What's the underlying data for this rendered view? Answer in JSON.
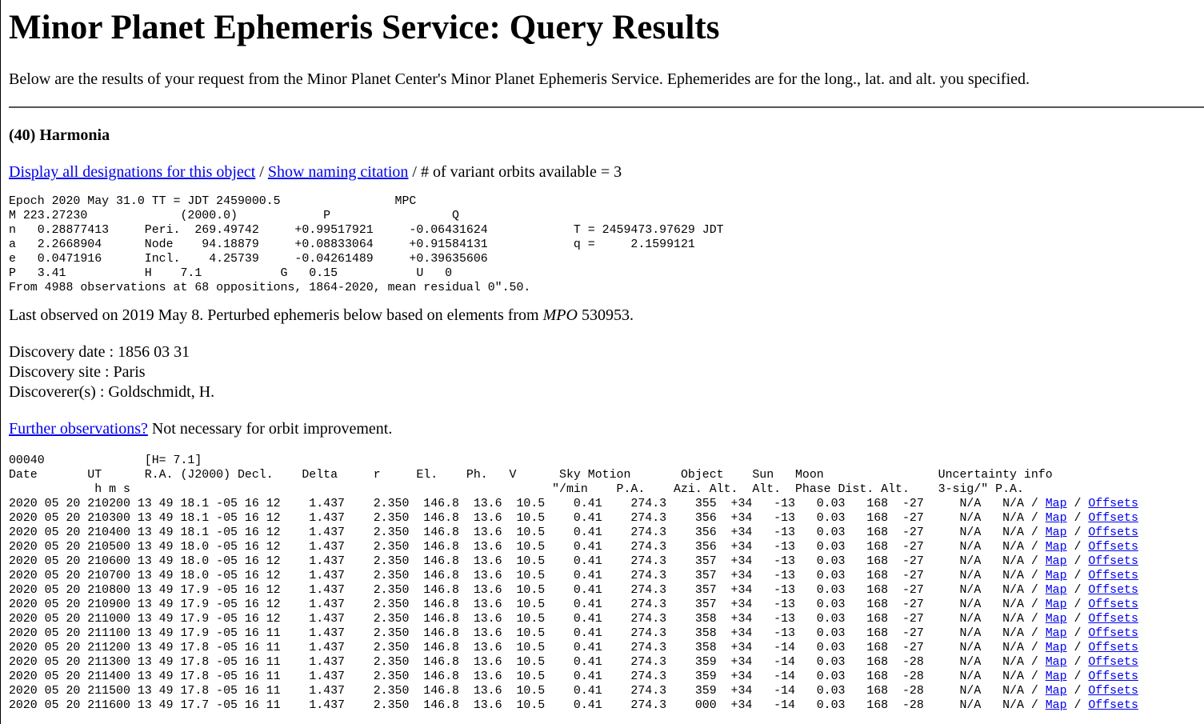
{
  "page": {
    "title": "Minor Planet Ephemeris Service: Query Results",
    "intro": "Below are the results of your request from the Minor Planet Center's Minor Planet Ephemeris Service. Ephemerides are for the long., lat. and alt. you specified."
  },
  "object": {
    "name": "(40) Harmonia",
    "link_designations": "Display all designations for this object",
    "sep1": " / ",
    "link_citation": "Show naming citation",
    "variant_text": " / # of variant orbits available = 3"
  },
  "elements_block": "Epoch 2020 May 31.0 TT = JDT 2459000.5                MPC\nM 223.27230             (2000.0)            P                 Q\nn   0.28877413     Peri.  269.49742     +0.99517921     -0.06431624            T = 2459473.97629 JDT\na   2.2668904      Node    94.18879     +0.08833064     +0.91584131            q =     2.1599121\ne   0.0471916      Incl.    4.25739     -0.04261489     +0.39635606\nP   3.41           H    7.1           G   0.15           U   0\nFrom 4988 observations at 68 oppositions, 1864-2020, mean residual 0\".50.",
  "last_observed": {
    "before": "Last observed on 2019 May 8. Perturbed ephemeris below based on elements from ",
    "italic": "MPO",
    "after": " 530953."
  },
  "discovery": {
    "date": "Discovery date : 1856 03 31",
    "site": "Discovery site : Paris",
    "discoverer": "Discoverer(s) : Goldschmidt, H."
  },
  "further": {
    "link": "Further observations?",
    "text": " Not necessary for orbit improvement."
  },
  "ephemeris": {
    "header_lines": [
      "00040              [H= 7.1]",
      "Date       UT      R.A. (J2000) Decl.    Delta     r     El.    Ph.   V      Sky Motion       Object    Sun   Moon                Uncertainty info",
      "            h m s                                                           \"/min    P.A.    Azi. Alt.  Alt.  Phase Dist. Alt.    3-sig/\" P.A."
    ],
    "rows": [
      "2020 05 20 210200 13 49 18.1 -05 16 12    1.437    2.350  146.8  13.6  10.5    0.41    274.3    355  +34   -13   0.03   168  -27     N/A   N/A / ",
      "2020 05 20 210300 13 49 18.1 -05 16 12    1.437    2.350  146.8  13.6  10.5    0.41    274.3    356  +34   -13   0.03   168  -27     N/A   N/A / ",
      "2020 05 20 210400 13 49 18.1 -05 16 12    1.437    2.350  146.8  13.6  10.5    0.41    274.3    356  +34   -13   0.03   168  -27     N/A   N/A / ",
      "2020 05 20 210500 13 49 18.0 -05 16 12    1.437    2.350  146.8  13.6  10.5    0.41    274.3    356  +34   -13   0.03   168  -27     N/A   N/A / ",
      "2020 05 20 210600 13 49 18.0 -05 16 12    1.437    2.350  146.8  13.6  10.5    0.41    274.3    357  +34   -13   0.03   168  -27     N/A   N/A / ",
      "2020 05 20 210700 13 49 18.0 -05 16 12    1.437    2.350  146.8  13.6  10.5    0.41    274.3    357  +34   -13   0.03   168  -27     N/A   N/A / ",
      "2020 05 20 210800 13 49 17.9 -05 16 12    1.437    2.350  146.8  13.6  10.5    0.41    274.3    357  +34   -13   0.03   168  -27     N/A   N/A / ",
      "2020 05 20 210900 13 49 17.9 -05 16 12    1.437    2.350  146.8  13.6  10.5    0.41    274.3    357  +34   -13   0.03   168  -27     N/A   N/A / ",
      "2020 05 20 211000 13 49 17.9 -05 16 12    1.437    2.350  146.8  13.6  10.5    0.41    274.3    358  +34   -13   0.03   168  -27     N/A   N/A / ",
      "2020 05 20 211100 13 49 17.9 -05 16 11    1.437    2.350  146.8  13.6  10.5    0.41    274.3    358  +34   -13   0.03   168  -27     N/A   N/A / ",
      "2020 05 20 211200 13 49 17.8 -05 16 11    1.437    2.350  146.8  13.6  10.5    0.41    274.3    358  +34   -14   0.03   168  -27     N/A   N/A / ",
      "2020 05 20 211300 13 49 17.8 -05 16 11    1.437    2.350  146.8  13.6  10.5    0.41    274.3    359  +34   -14   0.03   168  -28     N/A   N/A / ",
      "2020 05 20 211400 13 49 17.8 -05 16 11    1.437    2.350  146.8  13.6  10.5    0.41    274.3    359  +34   -14   0.03   168  -28     N/A   N/A / ",
      "2020 05 20 211500 13 49 17.8 -05 16 11    1.437    2.350  146.8  13.6  10.5    0.41    274.3    359  +34   -14   0.03   168  -28     N/A   N/A / ",
      "2020 05 20 211600 13 49 17.7 -05 16 11    1.437    2.350  146.8  13.6  10.5    0.41    274.3    000  +34   -14   0.03   168  -28     N/A   N/A / "
    ],
    "map_label": "Map",
    "offsets_label": "Offsets",
    "link_sep": " / "
  }
}
